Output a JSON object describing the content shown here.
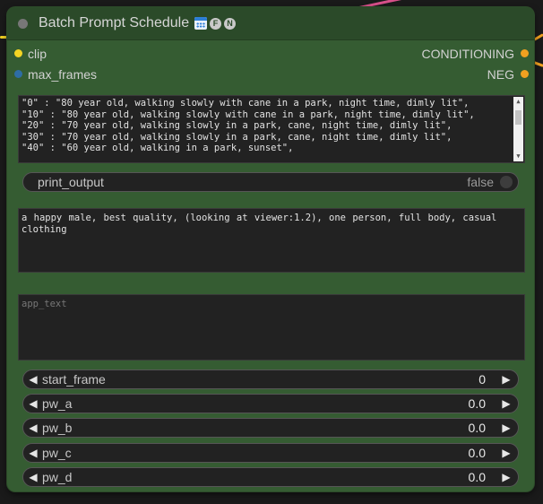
{
  "node": {
    "title": "Batch Prompt Schedule",
    "badges": [
      {
        "icon": "calendar-icon"
      },
      {
        "glyph": "F"
      },
      {
        "glyph": "N"
      }
    ],
    "colors": {
      "body": "#355c32",
      "title_bar": "#2b4a29",
      "clip_slot": "#f5d524",
      "max_frames_slot": "#2e6da4",
      "conditioning_slot": "#f0a020"
    }
  },
  "inputs": {
    "clip": "clip",
    "max_frames": "max_frames"
  },
  "outputs": {
    "conditioning": "CONDITIONING",
    "neg": "NEG"
  },
  "schedule_text": {
    "lines": [
      "\"0\" : \"80 year old, walking slowly with cane in a park, night time, dimly lit\",",
      "\"10\" : \"80 year old, walking slowly with cane in a park, night time, dimly lit\",",
      "\"20\" : \"70 year old, walking slowly in a park, cane, night time, dimly lit\",",
      "\"30\" : \"70 year old, walking slowly in a park, cane, night time, dimly lit\",",
      "\"40\" : \"60 year old, walking in a park, sunset\","
    ]
  },
  "print_output": {
    "label": "print_output",
    "value": "false"
  },
  "pre_text": {
    "value": "a happy male, best quality, (looking at viewer:1.2), one person, full body, casual clothing"
  },
  "app_text": {
    "placeholder": "app_text"
  },
  "number_widgets": [
    {
      "label": "start_frame",
      "value": "0"
    },
    {
      "label": "pw_a",
      "value": "0.0"
    },
    {
      "label": "pw_b",
      "value": "0.0"
    },
    {
      "label": "pw_c",
      "value": "0.0"
    },
    {
      "label": "pw_d",
      "value": "0.0"
    }
  ]
}
